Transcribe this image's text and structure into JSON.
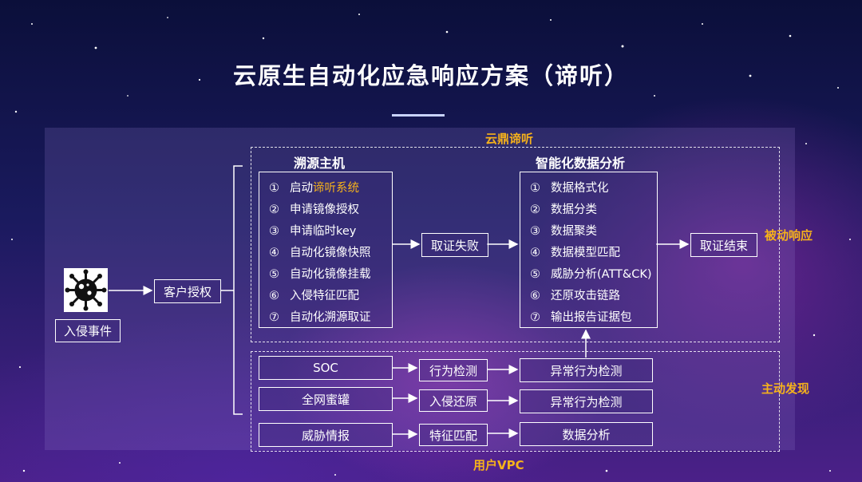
{
  "title": "云原生自动化应急响应方案（谛听）",
  "zones": {
    "top": "云鼎谛听",
    "bottom": "用户VPC",
    "passive": "被动响应",
    "active": "主动发现"
  },
  "left": {
    "event_label": "入侵事件",
    "auth_label": "客户授权"
  },
  "trace": {
    "header": "溯源主机",
    "items": [
      {
        "num": "①",
        "pre": "启动",
        "hl": "谛听系统"
      },
      {
        "num": "②",
        "pre": "申请镜像授权",
        "hl": ""
      },
      {
        "num": "③",
        "pre": "申请临时key",
        "hl": ""
      },
      {
        "num": "④",
        "pre": "自动化镜像快照",
        "hl": ""
      },
      {
        "num": "⑤",
        "pre": "自动化镜像挂载",
        "hl": ""
      },
      {
        "num": "⑥",
        "pre": "入侵特征匹配",
        "hl": ""
      },
      {
        "num": "⑦",
        "pre": "自动化溯源取证",
        "hl": ""
      }
    ]
  },
  "evidence_fail": "取证失败",
  "analysis": {
    "header": "智能化数据分析",
    "items": [
      {
        "num": "①",
        "text": "数据格式化"
      },
      {
        "num": "②",
        "text": "数据分类"
      },
      {
        "num": "③",
        "text": "数据聚类"
      },
      {
        "num": "④",
        "text": "数据模型匹配"
      },
      {
        "num": "⑤",
        "text": "威胁分析(ATT&CK)"
      },
      {
        "num": "⑥",
        "text": "还原攻击链路"
      },
      {
        "num": "⑦",
        "text": "输出报告证据包"
      }
    ]
  },
  "evidence_end": "取证结束",
  "sources": [
    {
      "source": "SOC",
      "process": "行为检测",
      "result": "异常行为检测"
    },
    {
      "source": "全网蜜罐",
      "process": "入侵还原",
      "result": "异常行为检测"
    },
    {
      "source": "威胁情报",
      "process": "特征匹配",
      "result": "数据分析"
    }
  ],
  "icons": {
    "event": "virus-icon"
  },
  "colors": {
    "accent": "#f6b21b",
    "text": "#ffffff"
  }
}
